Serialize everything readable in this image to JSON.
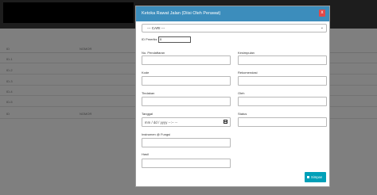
{
  "background": {
    "header_labels": [
      "ID",
      "NOMOR"
    ],
    "row_ids": [
      "ID-1",
      "ID-2",
      "ID-3",
      "ID-4",
      "ID-5",
      "ID"
    ],
    "footer_labels": [
      "ID",
      "NOMOR"
    ]
  },
  "modal": {
    "title": "Ketoka Rawat Jalan (Diisi Oleh Perawat)",
    "close_label": "x",
    "select": {
      "value": "--- CARI ---"
    },
    "fields": {
      "id_pemeriksaan_label": "ID Pmeriks",
      "id_pemeriksaan_value": "0",
      "no_pendaftaran_label": "No. Pendaftaran",
      "kesimpulan_label": "Kesimpulan",
      "kode_label": "Kode",
      "rekomendasi_label": "Rekomendasi",
      "tindakan_label": "Tindakan",
      "oleh_label": "Oleh",
      "tanggal_label": "Tanggal",
      "tanggal_placeholder": "mm / dd / yyyy  --:-- --",
      "status_label": "Status",
      "instrumen_label": "Instrumen @ Fungsi",
      "hasil_label": "Hasil"
    },
    "save_label": "Simpan"
  }
}
